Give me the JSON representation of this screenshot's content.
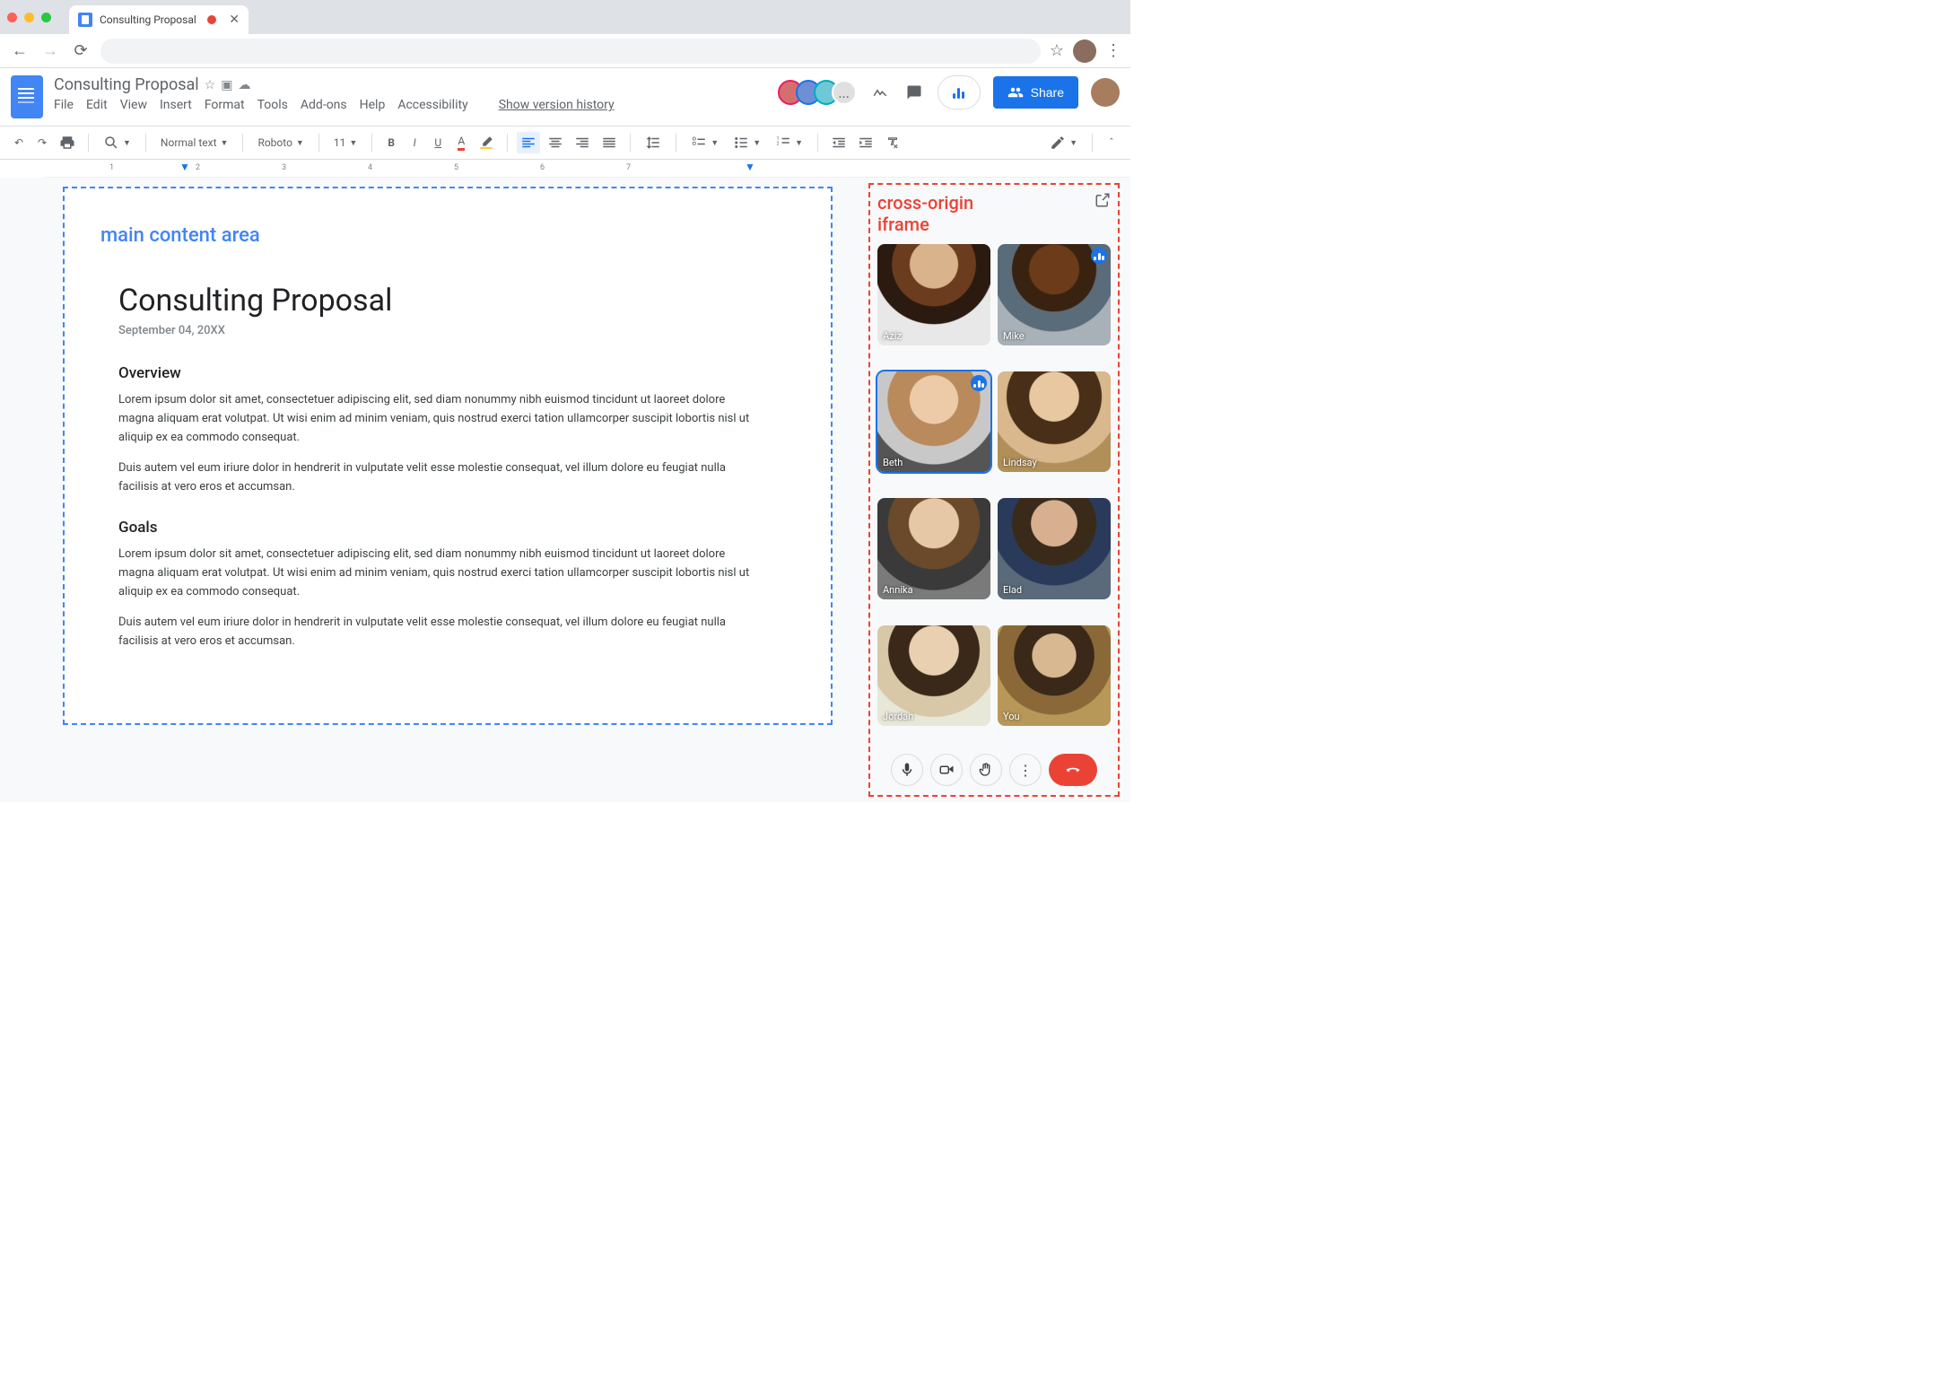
{
  "browser": {
    "tab_title": "Consulting Proposal"
  },
  "docs": {
    "title": "Consulting Proposal",
    "menus": [
      "File",
      "Edit",
      "View",
      "Insert",
      "Format",
      "Tools",
      "Add-ons",
      "Help",
      "Accessibility"
    ],
    "version_history": "Show version history",
    "collaborators_overflow": "...",
    "share_label": "Share"
  },
  "toolbar": {
    "zoom": "",
    "style": "Normal text",
    "font": "Roboto",
    "size": "11"
  },
  "ruler": {
    "numbers": [
      "1",
      "2",
      "3",
      "4",
      "5",
      "6",
      "7"
    ]
  },
  "annotations": {
    "main": "main content area",
    "iframe_l1": "cross-origin",
    "iframe_l2": "iframe"
  },
  "content": {
    "title": "Consulting Proposal",
    "date": "September 04, 20XX",
    "section1": "Overview",
    "para1": "Lorem ipsum dolor sit amet, consectetuer adipiscing elit, sed diam nonummy nibh euismod tincidunt ut laoreet dolore magna aliquam erat volutpat. Ut wisi enim ad minim veniam, quis nostrud exerci tation ullamcorper suscipit lobortis nisl ut aliquip ex ea commodo consequat.",
    "para2": "Duis autem vel eum iriure dolor in hendrerit in vulputate velit esse molestie consequat, vel illum dolore eu feugiat nulla facilisis at vero eros et accumsan.",
    "section2": "Goals",
    "para3": "Lorem ipsum dolor sit amet, consectetuer adipiscing elit, sed diam nonummy nibh euismod tincidunt ut laoreet dolore magna aliquam erat volutpat. Ut wisi enim ad minim veniam, quis nostrud exerci tation ullamcorper suscipit lobortis nisl ut aliquip ex ea commodo consequat.",
    "para4": "Duis autem vel eum iriure dolor in hendrerit in vulputate velit esse molestie consequat, vel illum dolore eu feugiat nulla facilisis at vero eros et accumsan."
  },
  "meet": {
    "participants": [
      {
        "name": "Aziz",
        "speaking": false
      },
      {
        "name": "Mike",
        "speaking": true
      },
      {
        "name": "Beth",
        "speaking": true
      },
      {
        "name": "Lindsay",
        "speaking": false
      },
      {
        "name": "Annika",
        "speaking": false
      },
      {
        "name": "Elad",
        "speaking": false
      },
      {
        "name": "Jordan",
        "speaking": false
      },
      {
        "name": "You",
        "speaking": false
      }
    ]
  }
}
